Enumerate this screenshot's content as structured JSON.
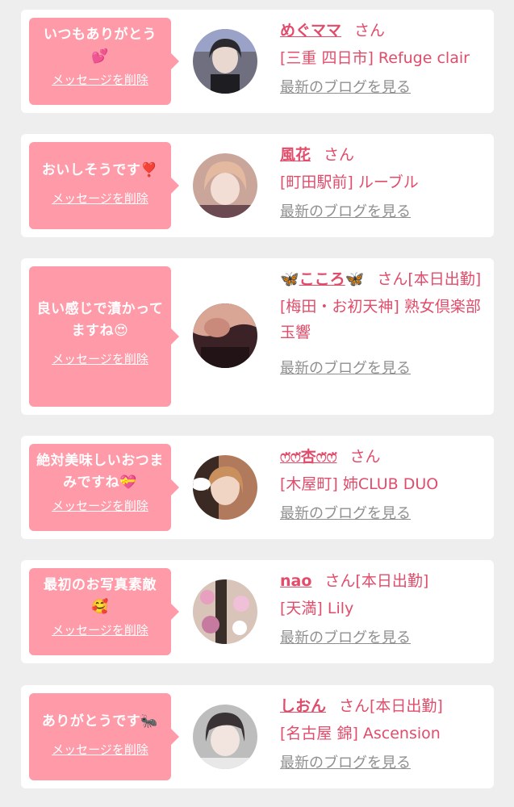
{
  "colors": {
    "accent": "#e04c6a",
    "bubble": "#ff9aa8",
    "muted": "#8f8f8f"
  },
  "items": [
    {
      "message": "いつもありがとう",
      "message_icon": "💕",
      "delete": "メッセージを削除",
      "name": "めぐママ",
      "suffix": "さん",
      "shop": "[三重 四日市] Refuge clair",
      "blog": "最新のブログを見る"
    },
    {
      "message": "おいしそうです",
      "message_icon": "❣️",
      "delete": "メッセージを削除",
      "name": "風花",
      "suffix": "さん",
      "shop": "[町田駅前] ルーブル",
      "blog": "最新のブログを見る"
    },
    {
      "message": "良い感じで漬かってますね",
      "message_icon": "😍",
      "delete": "メッセージを削除",
      "name": "こころ",
      "name_icon": "🦋",
      "suffix": "さん[本日出勤]",
      "shop": "[梅田・お初天神] 熟女倶楽部 玉響",
      "blog": "最新のブログを見る"
    },
    {
      "message": "絶対美味しいおつまみですね",
      "message_icon": "💝",
      "delete": "メッセージを削除",
      "name": "ෆ̈ෆ̈杏ෆ̈ෆ̈",
      "suffix": "さん",
      "shop": "[木屋町] 姉CLUB DUO",
      "blog": "最新のブログを見る"
    },
    {
      "message": "最初のお写真素敵",
      "message_icon": "🥰",
      "delete": "メッセージを削除",
      "name": "nao",
      "suffix": "さん[本日出勤]",
      "shop": "[天満] Lily",
      "blog": "最新のブログを見る"
    },
    {
      "message": "ありがとうです",
      "message_icon": "🐜",
      "delete": "メッセージを削除",
      "name": "しおん",
      "suffix": "さん[本日出勤]",
      "shop": "[名古屋 錦] Ascension",
      "blog": "最新のブログを見る"
    }
  ]
}
